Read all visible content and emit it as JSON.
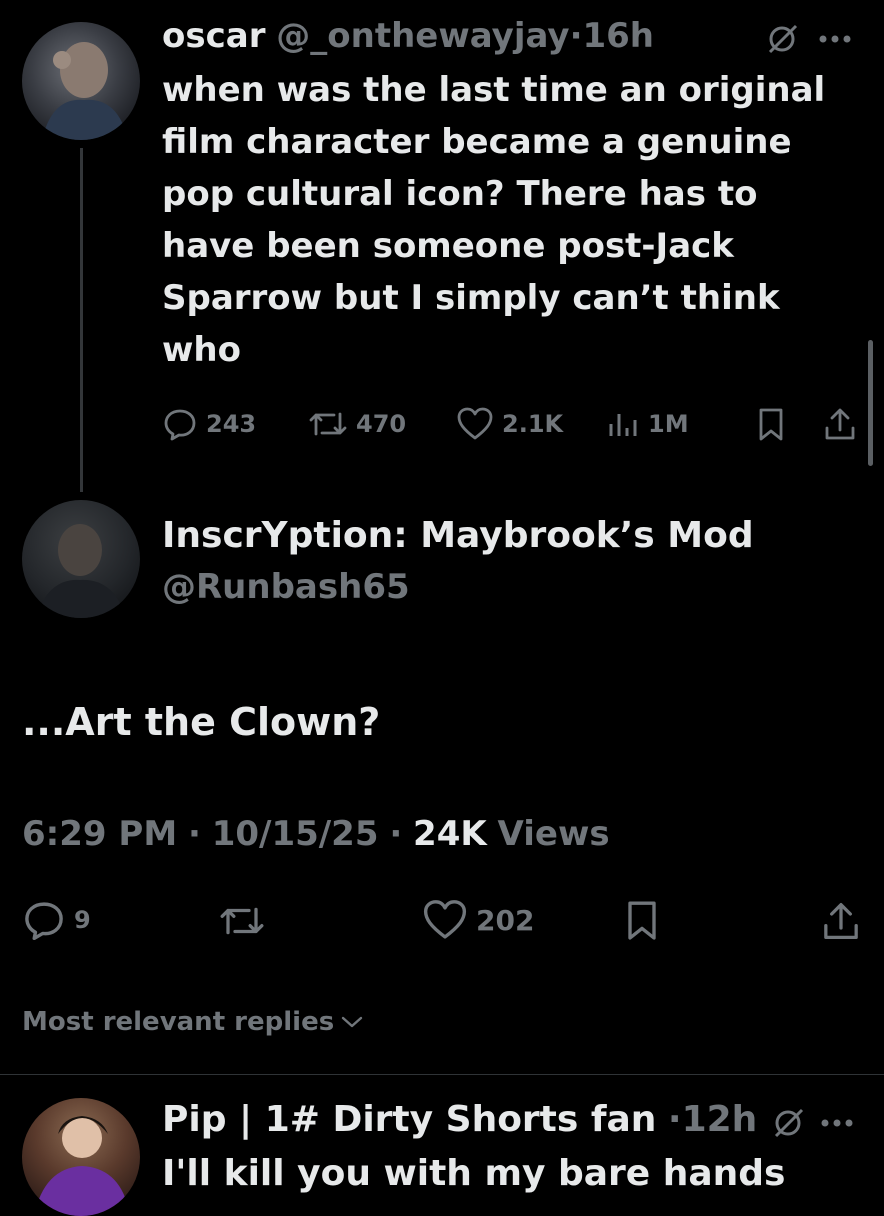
{
  "parent_tweet": {
    "display_name": "oscar",
    "handle": "@_onthewayjay",
    "separator": "·",
    "time": "16h",
    "text": "when was the last time an original\nfilm character became a genuine\npop cultural icon? There has to\nhave been someone post-Jack\nSparrow but I simply can’t think\nwho",
    "replies": "243",
    "reposts": "470",
    "likes": "2.1K",
    "views": "1M"
  },
  "main_tweet": {
    "display_name": "InscrYption: Maybrook’s Mod",
    "handle": "@Runbash65",
    "text": "...Art the Clown?",
    "time": "6:29 PM",
    "date": "10/15/25",
    "views_count": "24K",
    "views_label": "Views",
    "separator": "·",
    "replies": "9",
    "likes": "202"
  },
  "replies_filter": {
    "label": "Most relevant replies"
  },
  "reply_tweet": {
    "display_name": "Pip | 1# Dirty Shorts fan",
    "separator": "·",
    "time": "12h",
    "text": "I'll kill you with my bare hands"
  },
  "colors": {
    "background": "#000000",
    "text_primary": "#e7e9ea",
    "text_secondary": "#71767b",
    "divider": "#2f3336"
  }
}
